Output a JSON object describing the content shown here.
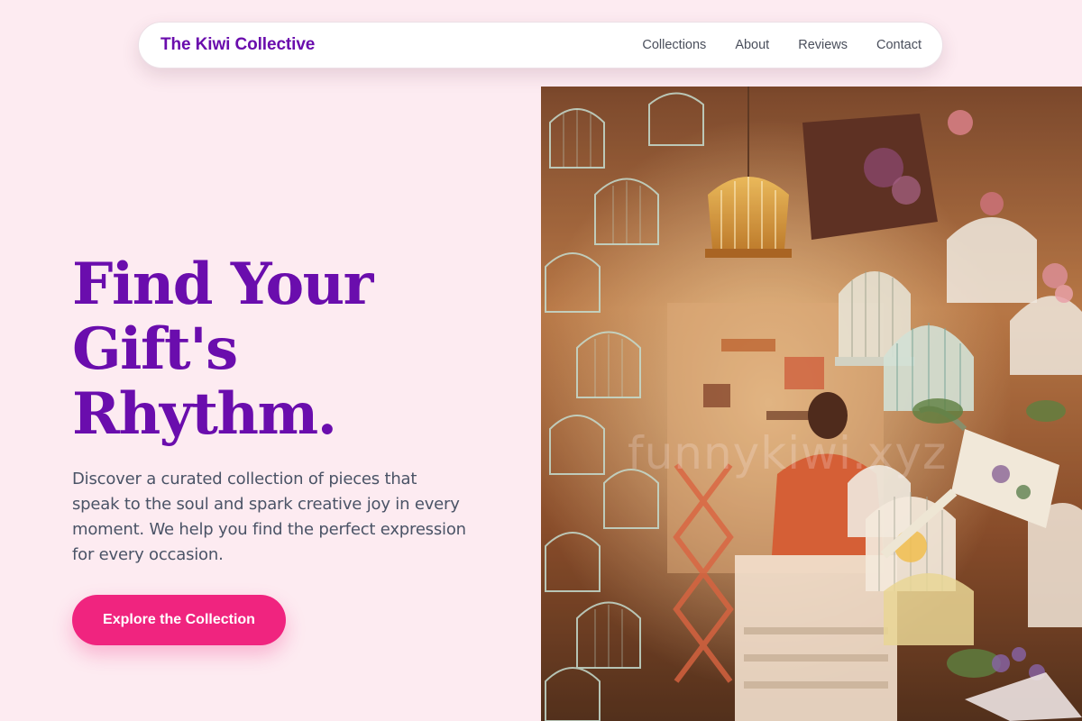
{
  "nav": {
    "brand": "The Kiwi Collective",
    "links": [
      {
        "label": "Collections"
      },
      {
        "label": "About"
      },
      {
        "label": "Reviews"
      },
      {
        "label": "Contact"
      }
    ]
  },
  "hero": {
    "title_lines": [
      "Find Your",
      "Gift's",
      "Rhythm."
    ],
    "description": "Discover a curated collection of pieces that speak to the soul and spark creative joy in every moment. We help you find the perfect expression for every occasion.",
    "cta_label": "Explore the Collection",
    "image": {
      "subject": "shop-with-hanging-birdcages",
      "watermark": "funnykiwi.xyz"
    }
  },
  "colors": {
    "page_background": "#fdebf1",
    "brand": "#6a0dad",
    "accent": "#f0247f",
    "body_text": "#4a5366",
    "nav_text": "#4a4f5c"
  }
}
